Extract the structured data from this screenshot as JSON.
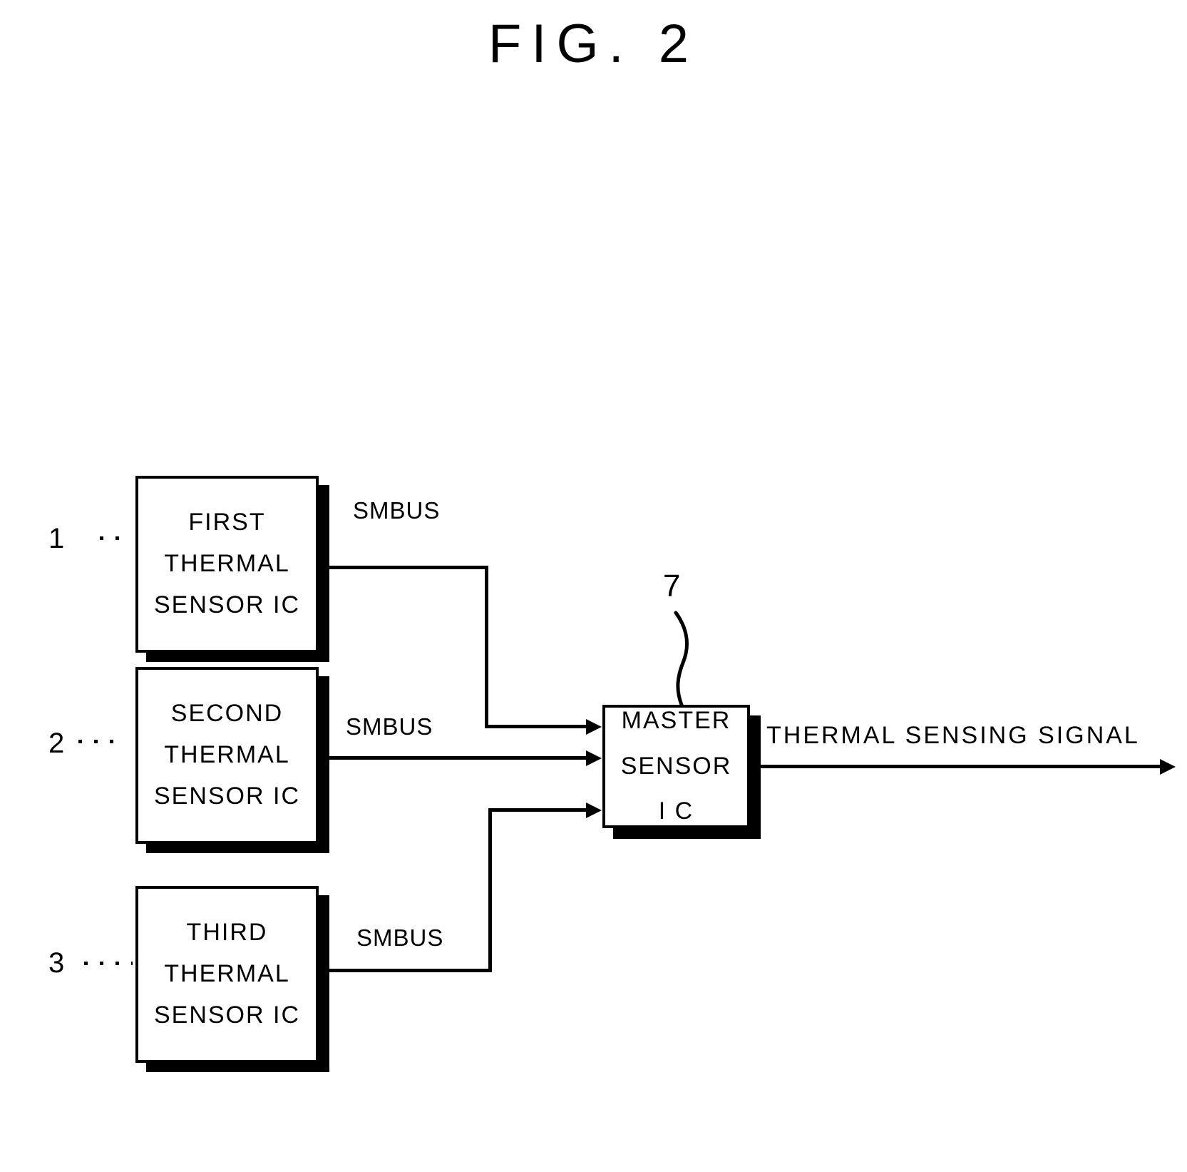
{
  "figure": {
    "title": "FIG. 2",
    "type": "patent-block-diagram"
  },
  "blocks": [
    {
      "id": "first-thermal-sensor-ic",
      "ref": "1",
      "lines": [
        "FIRST",
        "THERMAL",
        "SENSOR IC"
      ]
    },
    {
      "id": "second-thermal-sensor-ic",
      "ref": "2",
      "lines": [
        "SECOND",
        "THERMAL",
        "SENSOR IC"
      ]
    },
    {
      "id": "third-thermal-sensor-ic",
      "ref": "3",
      "lines": [
        "THIRD",
        "THERMAL",
        "SENSOR IC"
      ]
    },
    {
      "id": "master-sensor-ic",
      "ref": "7",
      "lines": [
        "MASTER",
        "SENSOR",
        "I C"
      ]
    }
  ],
  "connections": [
    {
      "id": "smbus-1",
      "label": "SMBUS",
      "from": "first-thermal-sensor-ic",
      "to": "master-sensor-ic"
    },
    {
      "id": "smbus-2",
      "label": "SMBUS",
      "from": "second-thermal-sensor-ic",
      "to": "master-sensor-ic"
    },
    {
      "id": "smbus-3",
      "label": "SMBUS",
      "from": "third-thermal-sensor-ic",
      "to": "master-sensor-ic"
    }
  ],
  "output": {
    "id": "thermal-sensing-signal",
    "label": "THERMAL SENSING SIGNAL"
  },
  "colors": {
    "ink": "#000000",
    "paper": "#ffffff"
  }
}
